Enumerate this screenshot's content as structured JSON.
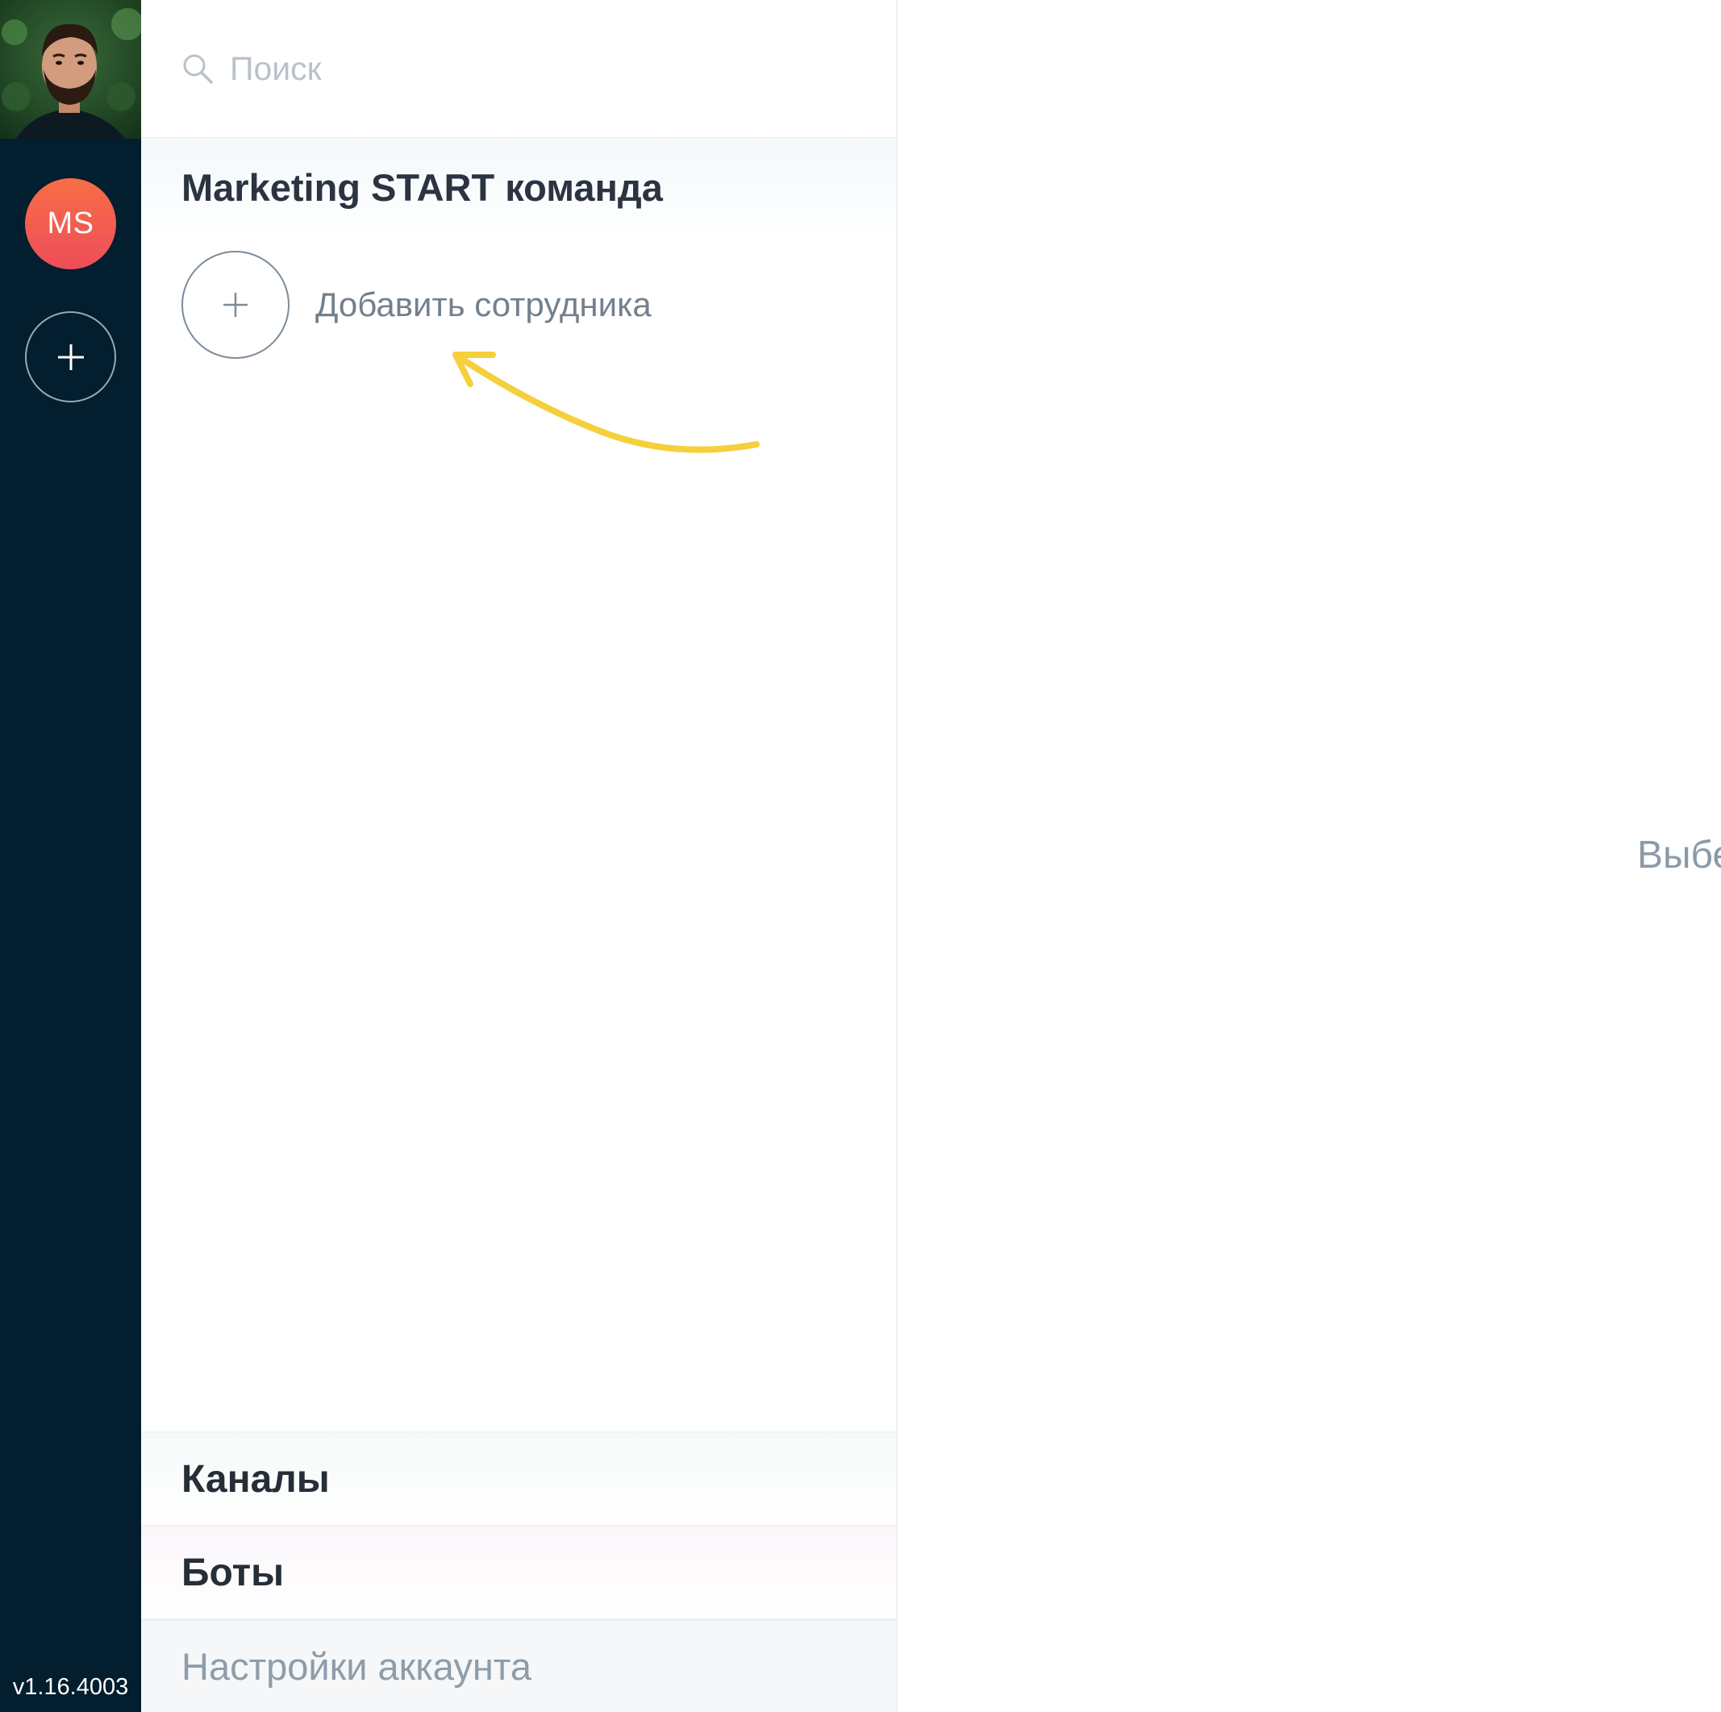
{
  "rail": {
    "team_initials": "MS",
    "version": "v1.16.4003"
  },
  "search": {
    "placeholder": "Поиск"
  },
  "team": {
    "title": "Marketing START команда",
    "add_employee_label": "Добавить сотрудника"
  },
  "sections": {
    "channels": "Каналы",
    "bots": "Боты",
    "settings": "Настройки аккаунта"
  },
  "main": {
    "hint_text": "Выбе"
  },
  "colors": {
    "rail_bg": "#031e2e",
    "team_badge": "#f4604f",
    "hint_arrow": "#f5cf3c"
  },
  "icons": {
    "search": "search-icon",
    "add_team": "plus-icon",
    "add_employee": "plus-icon",
    "hint": "curved-arrow-icon"
  }
}
